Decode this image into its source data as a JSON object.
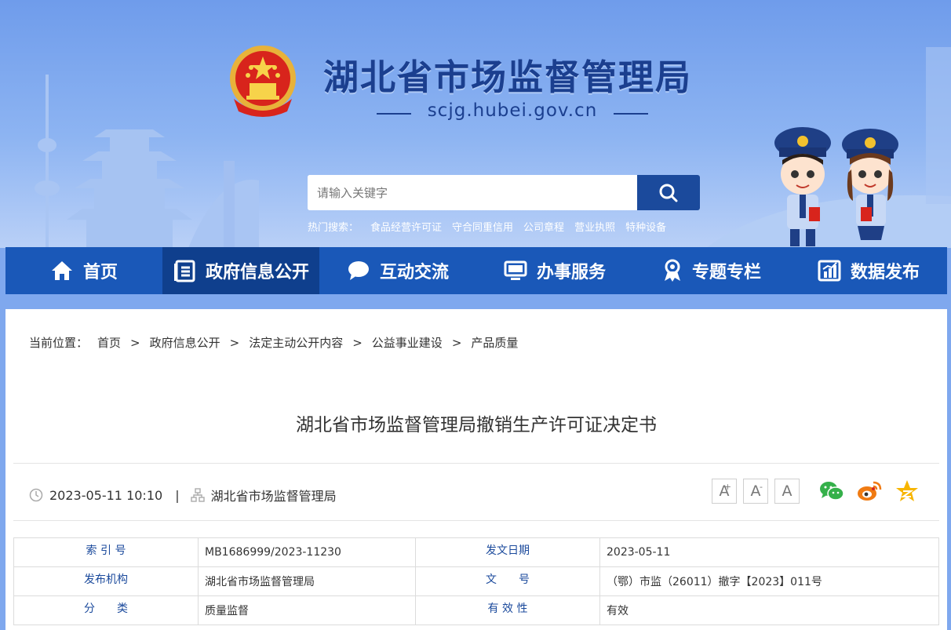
{
  "header": {
    "site_title": "湖北省市场监督管理局",
    "site_domain": "scjg.hubei.gov.cn",
    "search": {
      "placeholder": "请输入关键字"
    },
    "hot_search": {
      "label": "热门搜索：",
      "items": [
        "食品经营许可证",
        "守合同重信用",
        "公司章程",
        "营业执照",
        "特种设备"
      ]
    }
  },
  "nav": {
    "items": [
      {
        "label": "首页",
        "icon": "home-icon"
      },
      {
        "label": "政府信息公开",
        "icon": "document-list-icon"
      },
      {
        "label": "互动交流",
        "icon": "chat-bubble-icon"
      },
      {
        "label": "办事服务",
        "icon": "monitor-icon"
      },
      {
        "label": "专题专栏",
        "icon": "award-ribbon-icon"
      },
      {
        "label": "数据发布",
        "icon": "bar-chart-icon"
      }
    ],
    "active_index": 1
  },
  "breadcrumb": {
    "lead": "当前位置：",
    "items": [
      "首页",
      "政府信息公开",
      "法定主动公开内容",
      "公益事业建设",
      "产品质量"
    ],
    "separator": ">"
  },
  "article": {
    "title": "湖北省市场监督管理局撤销生产许可证决定书",
    "datetime": "2023-05-11 10:10",
    "divider": "|",
    "source": "湖北省市场监督管理局",
    "font_controls": [
      "A",
      "A",
      "A"
    ],
    "font_markers": [
      "+",
      "-"
    ],
    "share_icons": [
      "wechat-icon",
      "weibo-icon",
      "qzone-icon"
    ]
  },
  "info_table": {
    "rows": [
      {
        "k1": "索 引 号",
        "v1": "MB1686999/2023-11230",
        "k2": "发文日期",
        "v2": "2023-05-11"
      },
      {
        "k1": "发布机构",
        "v1": "湖北省市场监督管理局",
        "k2": "文　　号",
        "v2": "（鄂）市监（26011）撤字【2023】011号"
      },
      {
        "k1": "分　　类",
        "v1": "质量监督",
        "k2": "有 效 性",
        "v2": "有效"
      }
    ]
  },
  "colors": {
    "brand_blue": "#1b4a9c",
    "nav_blue": "#1a58b8",
    "nav_active": "#0f3f8d",
    "wechat_green": "#35b04a",
    "weibo_orange": "#f07b13",
    "qzone_yellow": "#f7b500"
  }
}
